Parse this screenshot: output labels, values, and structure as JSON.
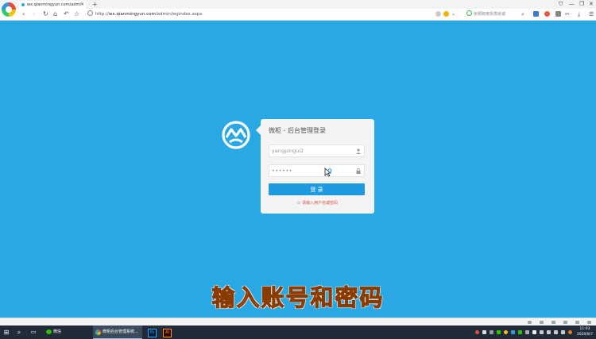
{
  "browser": {
    "tab_title": "wx.qianmingyun.com/admi",
    "tab_close": "×",
    "new_tab": "+",
    "window_controls": [
      "⛉",
      "—",
      "❐",
      "✕"
    ],
    "url_scheme": "http://",
    "url_host": "wx.qianmingyun.com",
    "url_path": "/admin/wgindex.aspx",
    "search_placeholder": "张颖跨夜拆蒸就诚"
  },
  "login": {
    "title": "微柜 - 后台管理登录",
    "username_value": "yangpingui2",
    "password_value": "••••••",
    "submit_label": "登 录",
    "error_message": "请输入用户名或密码"
  },
  "caption": "输入账号和密码",
  "taskbar": {
    "wechat_label": "微信",
    "browser_task_label": "微柜后台管理系统...",
    "ps_label": "Ps",
    "ai_label": "Ai",
    "time": "11:03",
    "date": "2020/8/7"
  },
  "colors": {
    "page_bg": "#29a8e4",
    "login_button": "#1e9be0",
    "error_text": "#d9534f",
    "caption_fill": "#f5a14a"
  }
}
